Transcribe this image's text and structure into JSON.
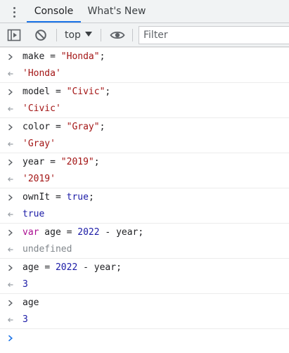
{
  "tabs": [
    {
      "label": "Console",
      "active": true
    },
    {
      "label": "What's New",
      "active": false
    }
  ],
  "toolbar": {
    "context": "top",
    "filter_placeholder": "Filter",
    "filter_value": ""
  },
  "icons": {
    "sidebar": "sidebar-toggle-icon",
    "clear": "clear-console-icon",
    "context_dropdown": "caret-down-icon",
    "live_expression": "eye-icon",
    "menu": "more-vertical-icon",
    "input": "chevron-right-icon",
    "output": "arrow-left-icon",
    "prompt": "chevron-right-icon"
  },
  "colors": {
    "accent": "#1a73e8",
    "string": "#a31515",
    "number": "#1a1aa6",
    "keyword": "#aa0d91",
    "undefined": "#80868b",
    "prompt": "#1a73e8"
  },
  "entries": [
    {
      "input": [
        {
          "t": "make ",
          "c": "plain"
        },
        {
          "t": "= ",
          "c": "op"
        },
        {
          "t": "\"Honda\"",
          "c": "str"
        },
        {
          "t": ";",
          "c": "plain"
        }
      ],
      "output": {
        "text": "'Honda'",
        "c": "str"
      }
    },
    {
      "input": [
        {
          "t": "model ",
          "c": "plain"
        },
        {
          "t": "= ",
          "c": "op"
        },
        {
          "t": "\"Civic\"",
          "c": "str"
        },
        {
          "t": ";",
          "c": "plain"
        }
      ],
      "output": {
        "text": "'Civic'",
        "c": "str"
      }
    },
    {
      "input": [
        {
          "t": "color ",
          "c": "plain"
        },
        {
          "t": "= ",
          "c": "op"
        },
        {
          "t": "\"Gray\"",
          "c": "str"
        },
        {
          "t": ";",
          "c": "plain"
        }
      ],
      "output": {
        "text": "'Gray'",
        "c": "str"
      }
    },
    {
      "input": [
        {
          "t": "year ",
          "c": "plain"
        },
        {
          "t": "= ",
          "c": "op"
        },
        {
          "t": "\"2019\"",
          "c": "str"
        },
        {
          "t": ";",
          "c": "plain"
        }
      ],
      "output": {
        "text": "'2019'",
        "c": "str"
      }
    },
    {
      "input": [
        {
          "t": "ownIt ",
          "c": "plain"
        },
        {
          "t": "= ",
          "c": "op"
        },
        {
          "t": "true",
          "c": "bool"
        },
        {
          "t": ";",
          "c": "plain"
        }
      ],
      "output": {
        "text": "true",
        "c": "bool"
      }
    },
    {
      "input": [
        {
          "t": "var",
          "c": "kw"
        },
        {
          "t": " age ",
          "c": "plain"
        },
        {
          "t": "= ",
          "c": "op"
        },
        {
          "t": "2022",
          "c": "num"
        },
        {
          "t": " - year;",
          "c": "plain"
        }
      ],
      "output": {
        "text": "undefined",
        "c": "undef"
      }
    },
    {
      "input": [
        {
          "t": "age ",
          "c": "plain"
        },
        {
          "t": "= ",
          "c": "op"
        },
        {
          "t": "2022",
          "c": "num"
        },
        {
          "t": " - year;",
          "c": "plain"
        }
      ],
      "output": {
        "text": "3",
        "c": "num"
      }
    },
    {
      "input": [
        {
          "t": "age",
          "c": "plain"
        }
      ],
      "output": {
        "text": "3",
        "c": "num"
      }
    }
  ]
}
